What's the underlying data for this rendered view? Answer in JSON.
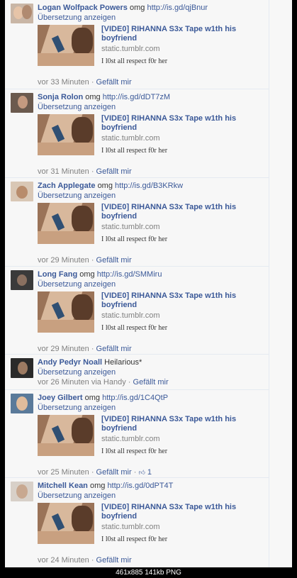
{
  "link_preview": {
    "title": "[VIDE0] RIHANNA S3x Tape w1th his boyfriend",
    "domain": "static.tumblr.com",
    "description": "I l0st all respect f0r her"
  },
  "translate_label": "Übersetzung anzeigen",
  "like_label": "Gefällt mir",
  "comments": [
    {
      "author": "Logan Wolfpack Powers",
      "message": "omg",
      "link": "http://is.gd/qjBnur",
      "time": "vor 33 Minuten",
      "via": "",
      "likes": ""
    },
    {
      "author": "Sonja Rolon",
      "message": "omg",
      "link": "http://is.gd/dDT7zM",
      "time": "vor 31 Minuten",
      "via": "",
      "likes": ""
    },
    {
      "author": "Zach Applegate",
      "message": "omg",
      "link": "http://is.gd/B3KRkw",
      "time": "vor 29 Minuten",
      "via": "",
      "likes": ""
    },
    {
      "author": "Long Fang",
      "message": "omg",
      "link": "http://is.gd/SMMiru",
      "time": "vor 29 Minuten",
      "via": "",
      "likes": ""
    },
    {
      "author": "Andy Pedyr Noall",
      "message": "Heilarious*",
      "link": "",
      "time": "vor 26 Minuten via Handy",
      "via": "",
      "likes": ""
    },
    {
      "author": "Joey Gilbert",
      "message": "omg",
      "link": "http://is.gd/1C4QtP",
      "time": "vor 25 Minuten",
      "via": "",
      "likes": "1"
    },
    {
      "author": "Mitchell Kean",
      "message": "omg",
      "link": "http://is.gd/0dPT4T",
      "time": "vor 24 Minuten",
      "via": "",
      "likes": ""
    }
  ],
  "status_bar": "461x885  141kb  PNG",
  "colors": {
    "link": "#3b5998",
    "meta": "#808080",
    "background": "#f7f7f7"
  }
}
